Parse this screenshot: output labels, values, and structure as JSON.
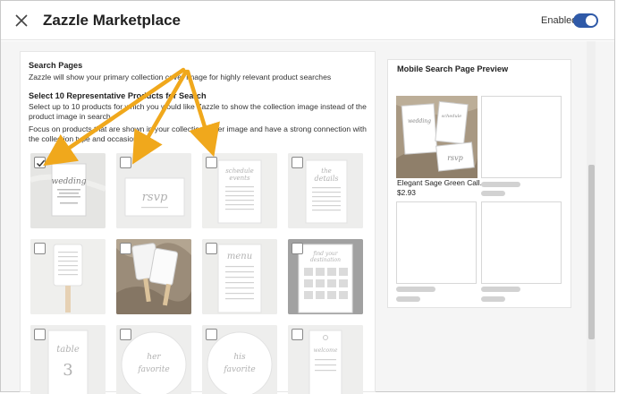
{
  "header": {
    "title": "Zazzle Marketplace",
    "enabled_label": "Enabled",
    "enabled": true
  },
  "search_pages": {
    "heading": "Search Pages",
    "description": "Zazzle will show your primary collection cover image for highly relevant product searches",
    "select_heading": "Select 10 Representative Products for Search",
    "select_description": "Select up to 10 products for which you would like Zazzle to show the collection image instead of the product image in search.",
    "focus_note": "Focus on products that are shown in your collection cover image and have a strong connection with the collection type and occasion",
    "products": [
      {
        "label": "wedding",
        "checked": true
      },
      {
        "label": "rsvp",
        "checked": false
      },
      {
        "label": "schedule of events",
        "checked": false
      },
      {
        "label": "the details",
        "checked": false
      },
      {
        "label": "program fan",
        "checked": false
      },
      {
        "label": "fan on fabric",
        "checked": false
      },
      {
        "label": "menu",
        "checked": false
      },
      {
        "label": "find your destination",
        "checked": false
      },
      {
        "label": "table 3",
        "checked": false
      },
      {
        "label": "her favorite",
        "checked": false
      },
      {
        "label": "his favorite",
        "checked": false
      },
      {
        "label": "welcome",
        "checked": false
      }
    ]
  },
  "preview": {
    "title": "Mobile Search Page Preview",
    "product_name": "Elegant Sage Green Call...",
    "product_price": "$2.93"
  },
  "colors": {
    "toggle_on": "#2f5aa8",
    "arrow": "#f0a81c"
  }
}
